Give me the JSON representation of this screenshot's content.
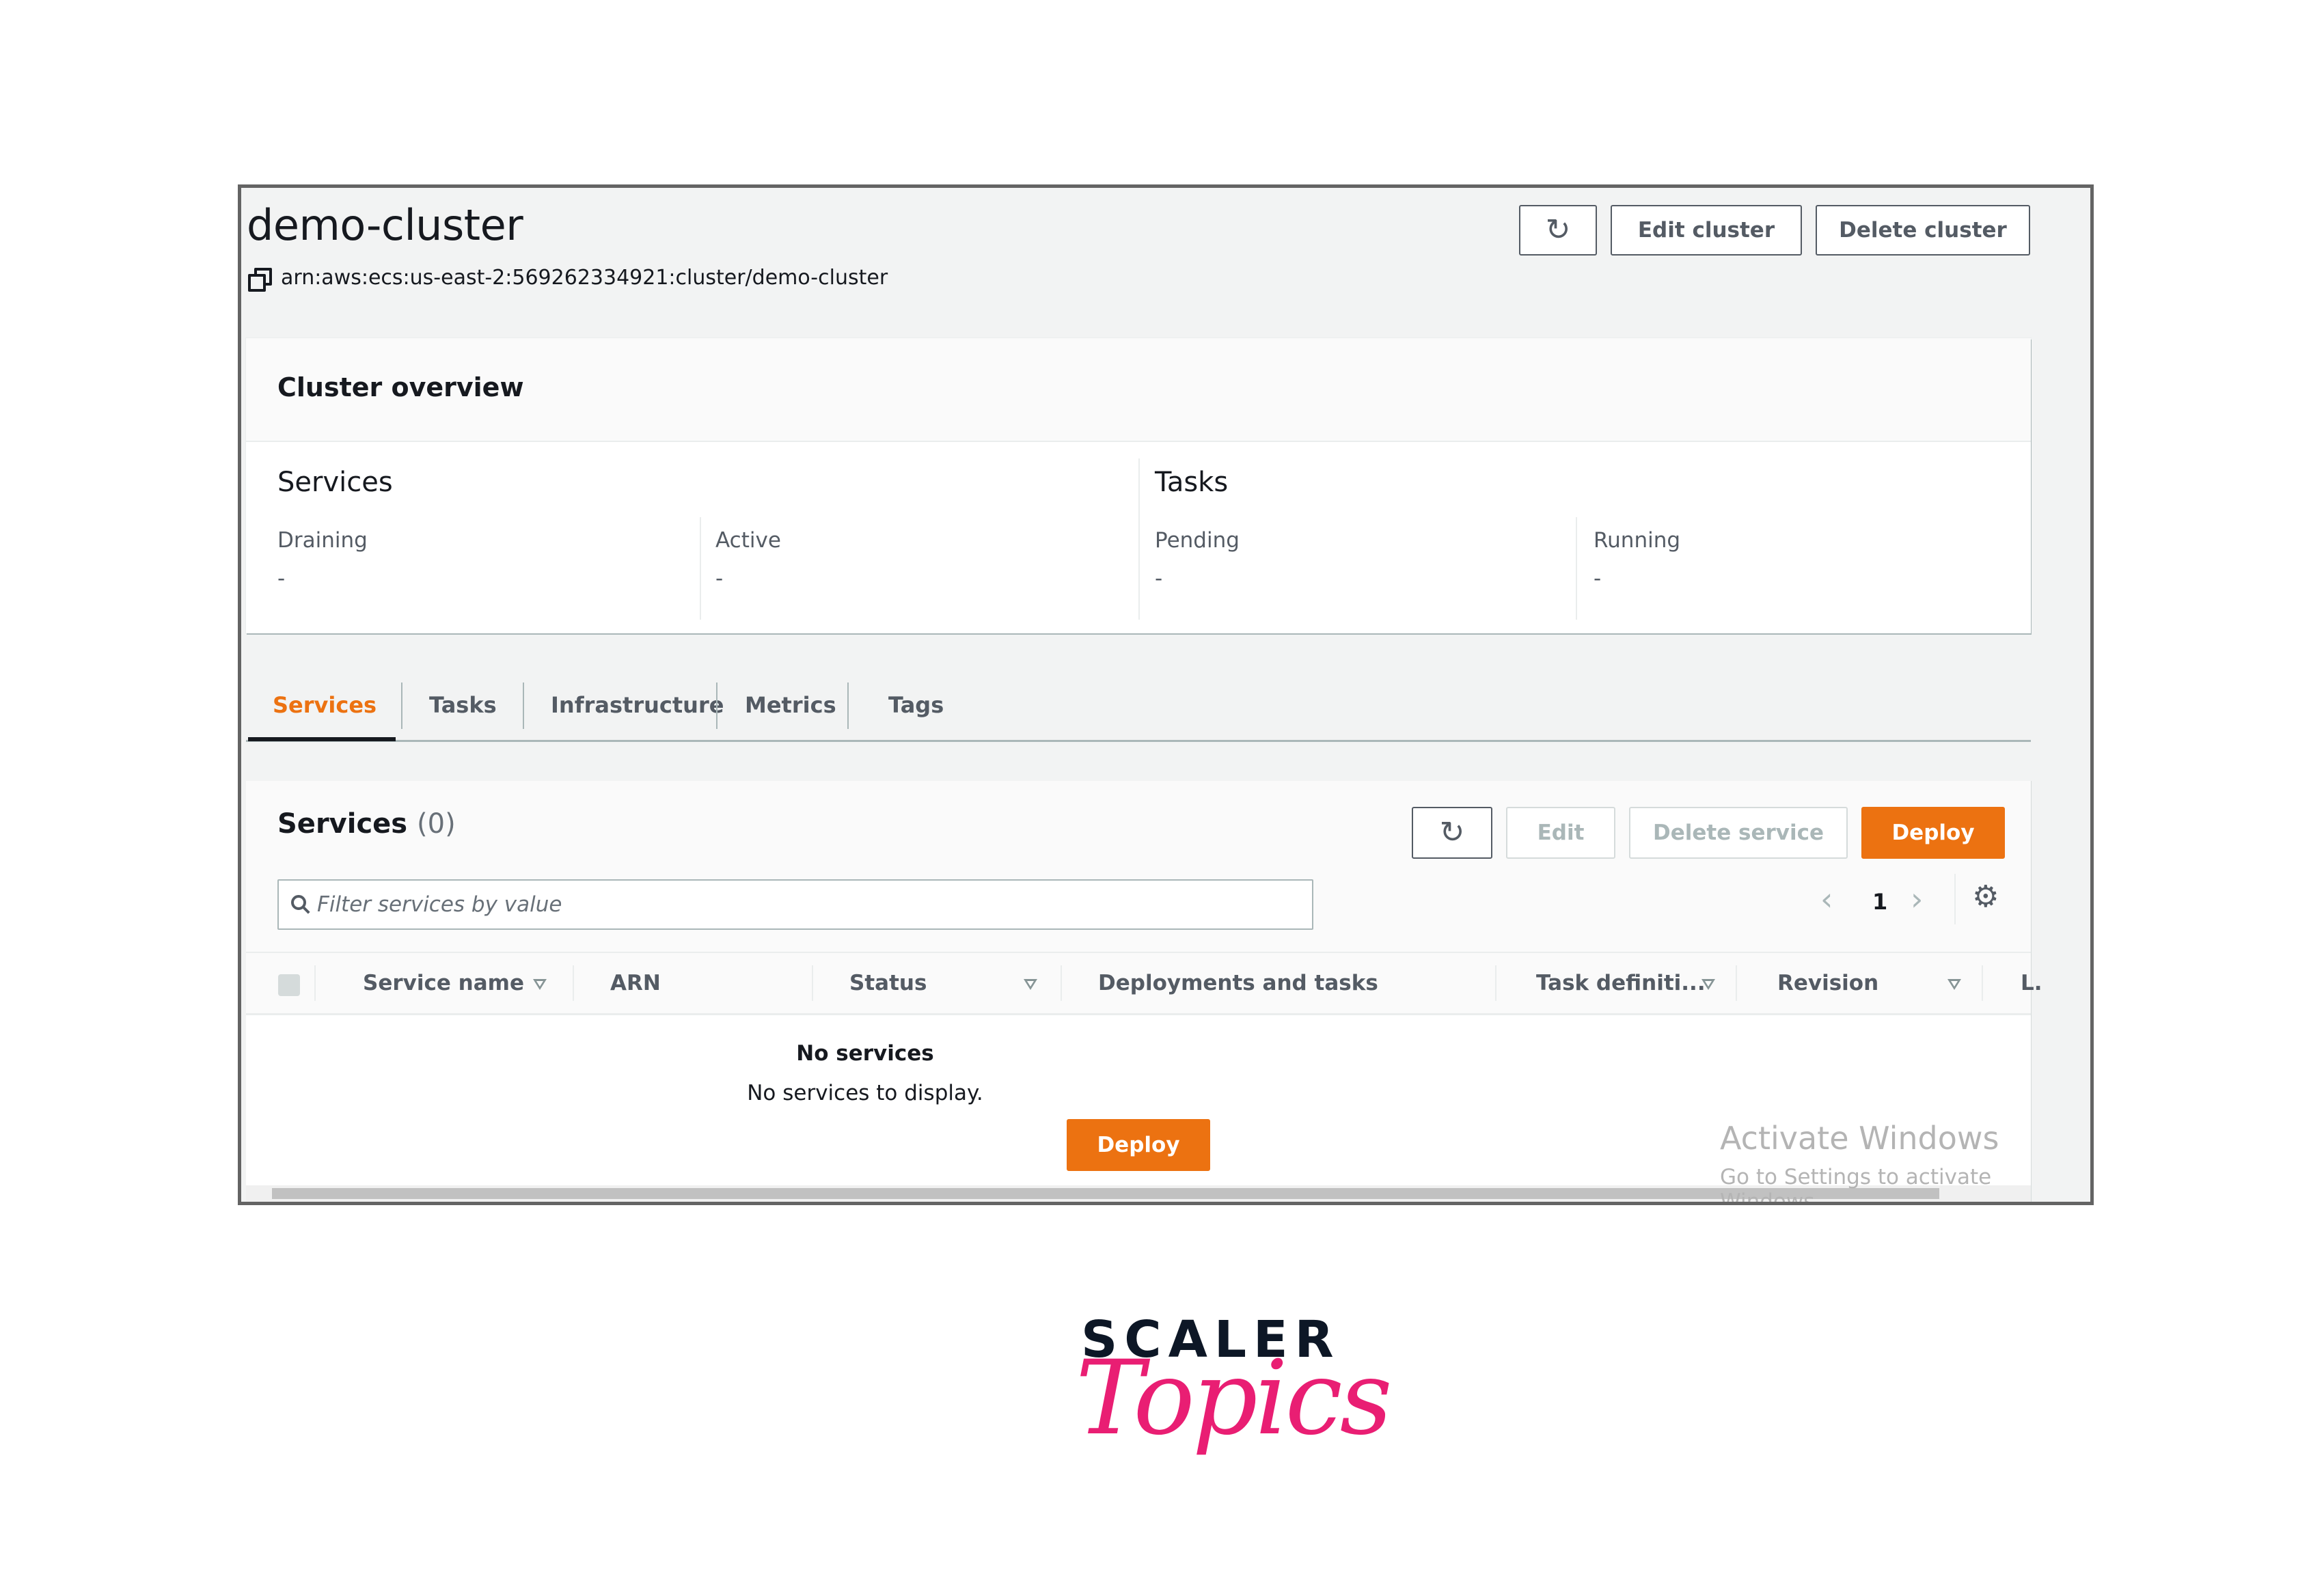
{
  "cluster": {
    "title": "demo-cluster",
    "arn": "arn:aws:ecs:us-east-2:569262334921:cluster/demo-cluster",
    "actions": {
      "refresh_icon": "refresh-icon",
      "edit_label": "Edit cluster",
      "delete_label": "Delete cluster"
    }
  },
  "overview": {
    "title": "Cluster overview",
    "services": {
      "heading": "Services",
      "items": [
        {
          "label": "Draining",
          "value": "-"
        },
        {
          "label": "Active",
          "value": "-"
        }
      ]
    },
    "tasks": {
      "heading": "Tasks",
      "items": [
        {
          "label": "Pending",
          "value": "-"
        },
        {
          "label": "Running",
          "value": "-"
        }
      ]
    }
  },
  "tabs": [
    {
      "label": "Services",
      "active": true
    },
    {
      "label": "Tasks",
      "active": false
    },
    {
      "label": "Infrastructure",
      "active": false
    },
    {
      "label": "Metrics",
      "active": false
    },
    {
      "label": "Tags",
      "active": false
    }
  ],
  "services_panel": {
    "title": "Services",
    "count": "(0)",
    "buttons": {
      "refresh_icon": "refresh-icon",
      "edit_label": "Edit",
      "edit_disabled": true,
      "delete_label": "Delete service",
      "delete_disabled": true,
      "deploy_label": "Deploy"
    },
    "search": {
      "placeholder": "Filter services by value",
      "value": ""
    },
    "pagination": {
      "current_page": "1",
      "prev_icon": "chevron-left-icon",
      "next_icon": "chevron-right-icon",
      "settings_icon": "gear-icon"
    },
    "table": {
      "columns": [
        {
          "label": "Service name",
          "sortable": true
        },
        {
          "label": "ARN",
          "sortable": false
        },
        {
          "label": "Status",
          "sortable": true
        },
        {
          "label": "Deployments and tasks",
          "sortable": false
        },
        {
          "label": "Task definiti...",
          "sortable": true
        },
        {
          "label": "Revision",
          "sortable": true
        },
        {
          "label": "L.",
          "sortable": false
        }
      ],
      "rows": [],
      "empty": {
        "title": "No services",
        "message": "No services to display.",
        "action_label": "Deploy"
      }
    }
  },
  "os_watermark": {
    "line1": "Activate Windows",
    "line2": "Go to Settings to activate Windows."
  },
  "brand": {
    "line1": "SCALER",
    "line2": "Topics"
  },
  "colors": {
    "accent": "#ec7211",
    "text_primary": "#16191f",
    "text_secondary": "#545b64",
    "brand_dark": "#0d1726",
    "brand_pink": "#e91e73"
  }
}
